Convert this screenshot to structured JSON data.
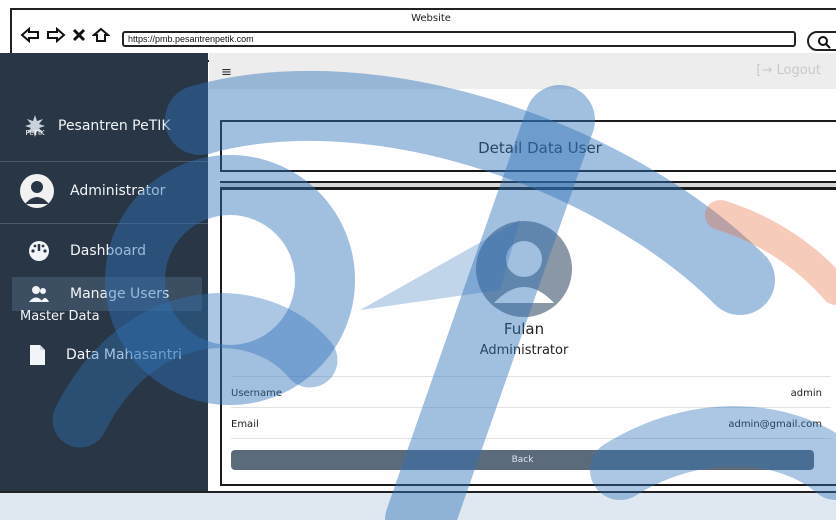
{
  "browser": {
    "window_title": "Website",
    "url": "https://pmb.pesantrenpetik.com"
  },
  "sidebar": {
    "brand": "Pesantren PeTIK",
    "user": "Administrator",
    "items": [
      {
        "label": "Dashboard",
        "icon": "dashboard-icon"
      },
      {
        "label": "Manage Users",
        "icon": "users-icon",
        "active": true
      }
    ],
    "section_label": "Master Data",
    "section_items": [
      {
        "label": "Data Mahasantri",
        "icon": "document-icon"
      }
    ]
  },
  "topbar": {
    "menu_glyph": "≡",
    "logout_label": "[→ Logout"
  },
  "detail": {
    "title": "Detail Data User",
    "name": "Fulan",
    "role": "Administrator",
    "fields": [
      {
        "label": "Username",
        "value": "admin"
      },
      {
        "label": "Email",
        "value": "admin@gmail.com"
      }
    ],
    "back_label": "Back"
  },
  "colors": {
    "sidebar_bg": "#283645",
    "button_bg": "#5b6b7c",
    "watermark": "#2f72b8",
    "watermark_accent": "#e96a3a"
  }
}
